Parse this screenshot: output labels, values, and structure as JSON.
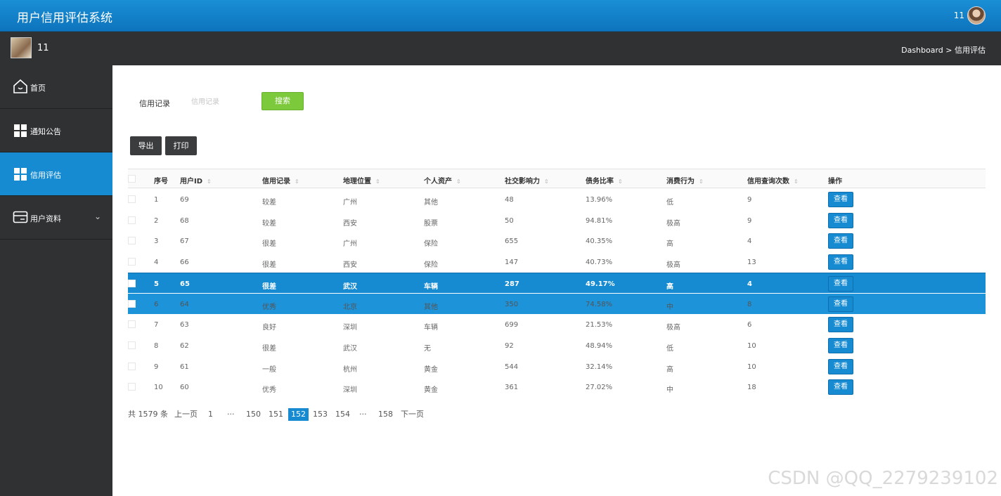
{
  "header": {
    "title": "用户信用评估系统",
    "username": "11"
  },
  "subbar": {
    "username": "11",
    "breadcrumb": "Dashboard > 信用评估"
  },
  "sidebar": {
    "items": [
      {
        "label": "首页",
        "icon": "home-icon"
      },
      {
        "label": "通知公告",
        "icon": "grid-icon"
      },
      {
        "label": "信用评估",
        "icon": "grid-icon",
        "active": true
      },
      {
        "label": "用户资料",
        "icon": "card-icon",
        "chevron": "⌄"
      }
    ]
  },
  "search": {
    "label": "信用记录",
    "placeholder": "信用记录",
    "value": "",
    "button": "搜索"
  },
  "toolbar": {
    "export_label": "导出",
    "print_label": "打印"
  },
  "table": {
    "columns": [
      "序号",
      "用户ID",
      "信用记录",
      "地理位置",
      "个人资产",
      "社交影响力",
      "债务比率",
      "消费行为",
      "信用查询次数",
      "操作"
    ],
    "sortable_icon": "⇕",
    "action_label": "查看",
    "rows": [
      [
        "1",
        "69",
        "较差",
        "广州",
        "其他",
        "48",
        "13.96%",
        "低",
        "9"
      ],
      [
        "2",
        "68",
        "较差",
        "西安",
        "股票",
        "50",
        "94.81%",
        "极高",
        "9"
      ],
      [
        "3",
        "67",
        "很差",
        "广州",
        "保险",
        "655",
        "40.35%",
        "高",
        "4"
      ],
      [
        "4",
        "66",
        "很差",
        "西安",
        "保险",
        "147",
        "40.73%",
        "极高",
        "13"
      ],
      [
        "5",
        "65",
        "很差",
        "武汉",
        "车辆",
        "287",
        "49.17%",
        "高",
        "4"
      ],
      [
        "6",
        "64",
        "优秀",
        "北京",
        "其他",
        "350",
        "74.58%",
        "中",
        "8"
      ],
      [
        "7",
        "63",
        "良好",
        "深圳",
        "车辆",
        "699",
        "21.53%",
        "极高",
        "6"
      ],
      [
        "8",
        "62",
        "很差",
        "武汉",
        "无",
        "92",
        "48.94%",
        "低",
        "10"
      ],
      [
        "9",
        "61",
        "一般",
        "杭州",
        "黄金",
        "544",
        "32.14%",
        "高",
        "10"
      ],
      [
        "10",
        "60",
        "优秀",
        "深圳",
        "黄金",
        "361",
        "27.02%",
        "中",
        "18"
      ]
    ]
  },
  "pagination": {
    "total": "共 1579 条",
    "prev": "上一页",
    "pages": [
      "1",
      "···",
      "150",
      "151",
      "152",
      "153",
      "154",
      "···",
      "158"
    ],
    "current": "152",
    "next": "下一页"
  },
  "watermark": "CSDN @QQ_2279239102"
}
